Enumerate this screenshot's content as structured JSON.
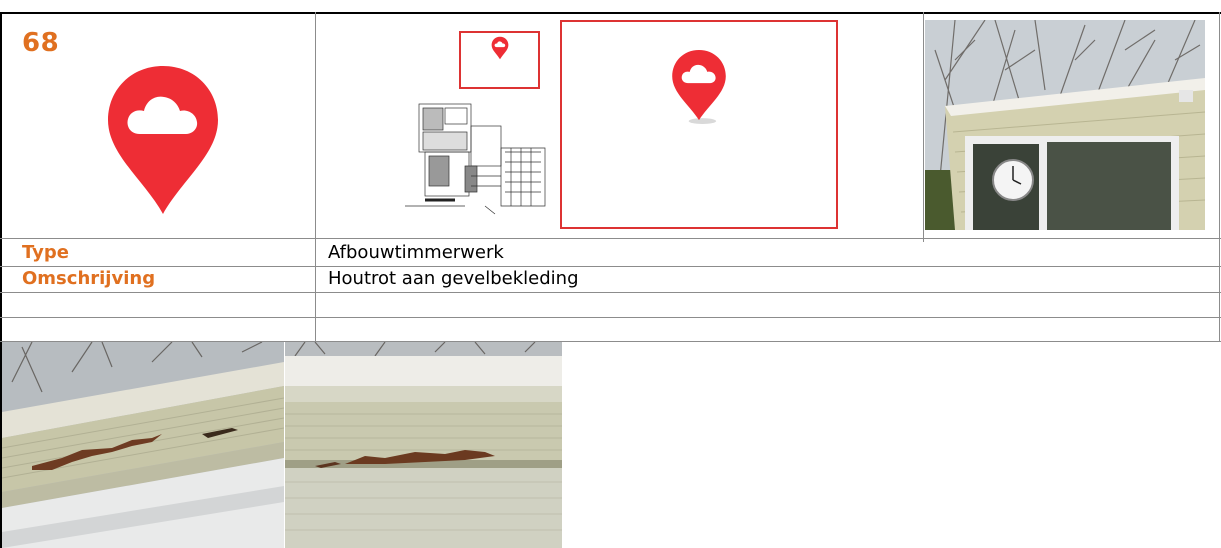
{
  "header": {
    "number": "68"
  },
  "rows": [
    {
      "label": "Type",
      "value": "Afbouwtimmerwerk"
    },
    {
      "label": "Omschrijving",
      "value": "Houtrot aan gevelbekleding"
    },
    {
      "label": "",
      "value": ""
    }
  ],
  "icons": {
    "location_marker": "cloud-map-pin-icon"
  },
  "colors": {
    "accent_orange": "#e07020",
    "marker_red": "#ee2d35",
    "frame_red": "#d33333"
  }
}
